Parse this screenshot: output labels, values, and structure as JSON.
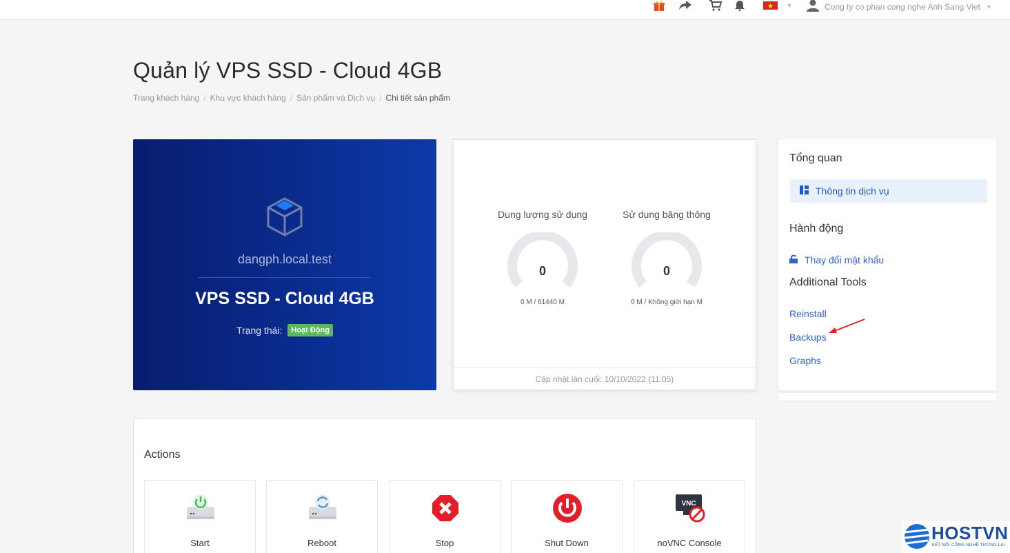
{
  "topbar": {
    "icons": [
      "gift-icon",
      "share-icon",
      "cart-icon",
      "bell-icon",
      "vietnam-flag-icon"
    ],
    "user_name": "Cong ty co phan cong nghe Anh Sang Viet"
  },
  "page": {
    "title": "Quản lý VPS SSD - Cloud 4GB",
    "breadcrumb": [
      "Trang khách hàng",
      "Khu vực khách hàng",
      "Sản phẩm và Dịch vụ",
      "Chi tiết sản phẩm"
    ]
  },
  "product": {
    "domain": "dangph.local.test",
    "name": "VPS SSD - Cloud 4GB",
    "status_label": "Trạng thái:",
    "status_value": "Hoạt Động",
    "status_color": "#5cb85c"
  },
  "usage": {
    "disk": {
      "title": "Dung lượng sử dụng",
      "value": "0",
      "caption": "0 M / 61440 M"
    },
    "bandwidth": {
      "title": "Sử dụng băng thông",
      "value": "0",
      "caption": "0 M / Không giới hạn M"
    },
    "last_updated": "Cập nhật lần cuối: 10/10/2022 (11:05)"
  },
  "sidebar": {
    "overview_heading": "Tổng quan",
    "overview_item": "Thông tin dịch vụ",
    "actions_heading": "Hành động",
    "change_password": "Thay đổi mật khẩu",
    "tools_heading": "Additional Tools",
    "tools": [
      "Reinstall",
      "Backups",
      "Graphs"
    ]
  },
  "actions": {
    "title": "Actions",
    "tiles": [
      "Start",
      "Reboot",
      "Stop",
      "Shut Down",
      "noVNC Console"
    ]
  },
  "logo": {
    "name": "HOSTVN",
    "tagline": "KẾT NỐI CÔNG NGHỆ TƯƠNG LAI"
  },
  "colors": {
    "accent": "#2f5fd0",
    "annotation_arrow": "#e0202a"
  }
}
